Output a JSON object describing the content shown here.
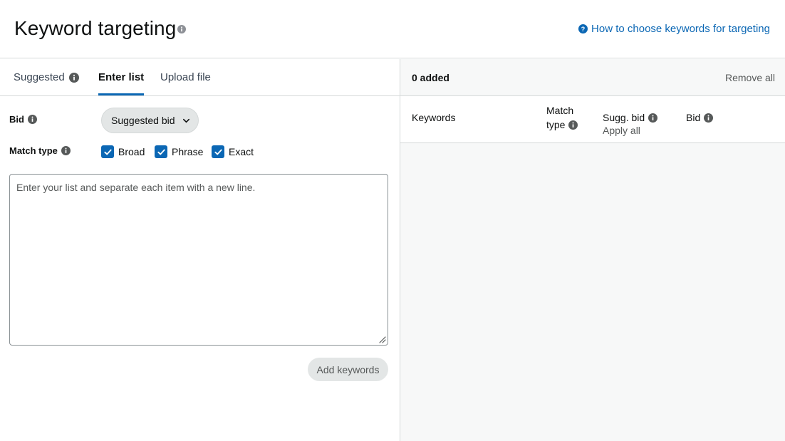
{
  "header": {
    "title": "Keyword targeting",
    "help_link": "How to choose keywords for targeting"
  },
  "tabs": [
    {
      "label": "Suggested",
      "active": false
    },
    {
      "label": "Enter list",
      "active": true
    },
    {
      "label": "Upload file",
      "active": false
    }
  ],
  "form": {
    "bid_label": "Bid",
    "bid_select_value": "Suggested bid",
    "match_type_label": "Match type",
    "match_types": [
      {
        "label": "Broad",
        "checked": true
      },
      {
        "label": "Phrase",
        "checked": true
      },
      {
        "label": "Exact",
        "checked": true
      }
    ],
    "textarea_placeholder": "Enter your list and separate each item with a new line.",
    "textarea_value": "",
    "add_button": "Add keywords"
  },
  "added_panel": {
    "count_label": "0 added",
    "remove_all": "Remove all",
    "columns": {
      "keywords": "Keywords",
      "match_type_line1": "Match",
      "match_type_line2": "type",
      "sugg_bid": "Sugg. bid",
      "apply_all": "Apply all",
      "bid": "Bid"
    }
  },
  "colors": {
    "accent": "#0b67b4",
    "text": "#0f1111",
    "muted": "#565959",
    "border": "#d5d9d9",
    "button_bg": "#e3e6e6",
    "panel_bg": "#f7f8f8"
  },
  "icons": [
    "info-icon",
    "help-circle-icon",
    "chevron-down-icon",
    "check-icon",
    "resize-handle-icon"
  ]
}
